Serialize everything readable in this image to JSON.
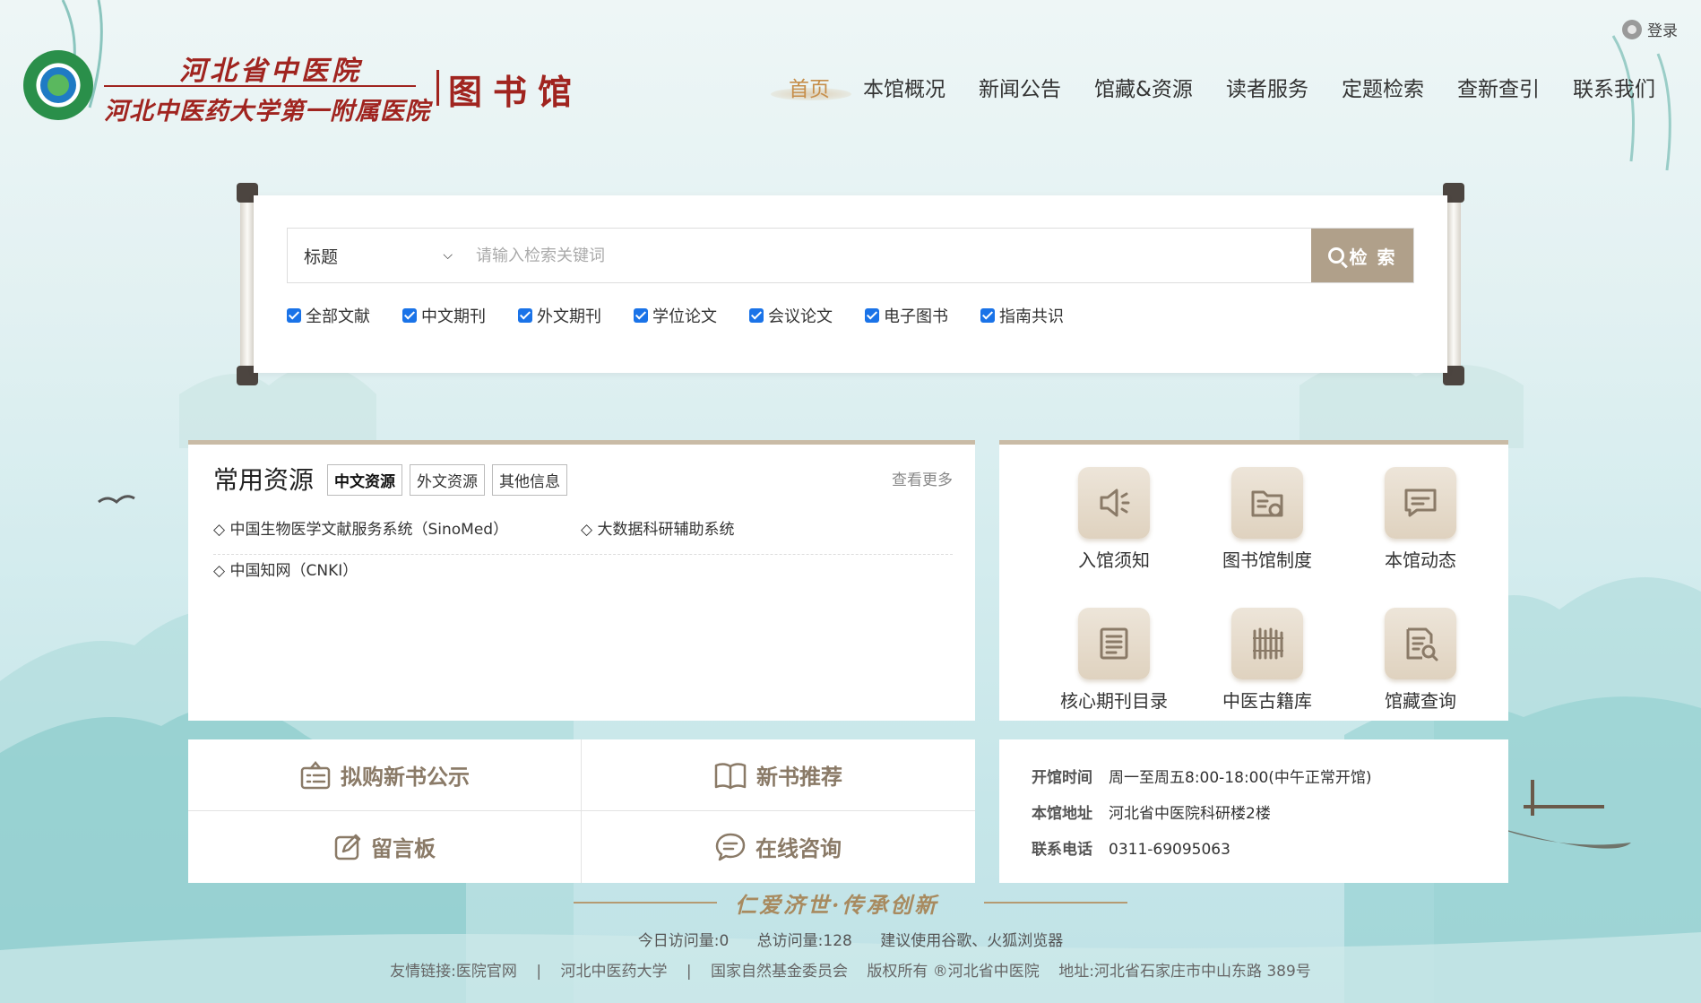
{
  "header": {
    "hospital_name_line1": "河北省中医院",
    "hospital_name_line2": "河北中医药大学第一附属医院",
    "library_name": "图书馆",
    "login_label": "登录"
  },
  "nav": {
    "items": [
      {
        "label": "首页",
        "active": true
      },
      {
        "label": "本馆概况"
      },
      {
        "label": "新闻公告"
      },
      {
        "label": "馆藏&资源"
      },
      {
        "label": "读者服务"
      },
      {
        "label": "定题检索"
      },
      {
        "label": "查新查引"
      },
      {
        "label": "联系我们"
      }
    ]
  },
  "search": {
    "field_selected": "标题",
    "placeholder": "请输入检索关键词",
    "value": "",
    "button_label": "检 索",
    "filters": [
      {
        "label": "全部文献",
        "checked": true
      },
      {
        "label": "中文期刊",
        "checked": true
      },
      {
        "label": "外文期刊",
        "checked": true
      },
      {
        "label": "学位论文",
        "checked": true
      },
      {
        "label": "会议论文",
        "checked": true
      },
      {
        "label": "电子图书",
        "checked": true
      },
      {
        "label": "指南共识",
        "checked": true
      }
    ]
  },
  "resources": {
    "title": "常用资源",
    "tabs": [
      {
        "label": "中文资源",
        "active": true
      },
      {
        "label": "外文资源"
      },
      {
        "label": "其他信息"
      }
    ],
    "more_label": "查看更多",
    "items": [
      {
        "label": "中国生物医学文献服务系统（SinoMed）"
      },
      {
        "label": "大数据科研辅助系统"
      },
      {
        "label": "中国知网（CNKI）"
      }
    ]
  },
  "services": {
    "items": [
      {
        "label": "入馆须知",
        "icon": "speaker-icon"
      },
      {
        "label": "图书馆制度",
        "icon": "folder-badge-icon"
      },
      {
        "label": "本馆动态",
        "icon": "message-icon"
      },
      {
        "label": "核心期刊目录",
        "icon": "list-doc-icon"
      },
      {
        "label": "中医古籍库",
        "icon": "bamboo-scroll-icon"
      },
      {
        "label": "馆藏查询",
        "icon": "doc-search-icon"
      }
    ]
  },
  "quick_links": {
    "items": [
      {
        "label": "拟购新书公示",
        "icon": "notice-board-icon"
      },
      {
        "label": "新书推荐",
        "icon": "open-book-icon"
      },
      {
        "label": "留言板",
        "icon": "edit-icon"
      },
      {
        "label": "在线咨询",
        "icon": "chat-icon"
      }
    ]
  },
  "info": {
    "hours_label": "开馆时间",
    "hours_value": "周一至周五8:00-18:00(中午正常开馆)",
    "address_label": "本馆地址",
    "address_value": "河北省中医院科研楼2楼",
    "phone_label": "联系电话",
    "phone_value": "0311-69095063"
  },
  "footer": {
    "slogan": "仁爱济世·传承创新",
    "today_visits": "今日访问量:0",
    "total_visits": "总访问量:128",
    "browser_tip": "建议使用谷歌、火狐浏览器",
    "links_prefix": "友情链接:医院官网",
    "sep": "|",
    "link2": "河北中医药大学",
    "link3": "国家自然基金委员会",
    "copyright": "版权所有 ®河北省中医院",
    "address": "地址:河北省石家庄市中山东路 389号"
  },
  "colors": {
    "accent_brown": "#b0a08a",
    "nav_active": "#c68e4a",
    "brand_red": "#a0241f"
  }
}
